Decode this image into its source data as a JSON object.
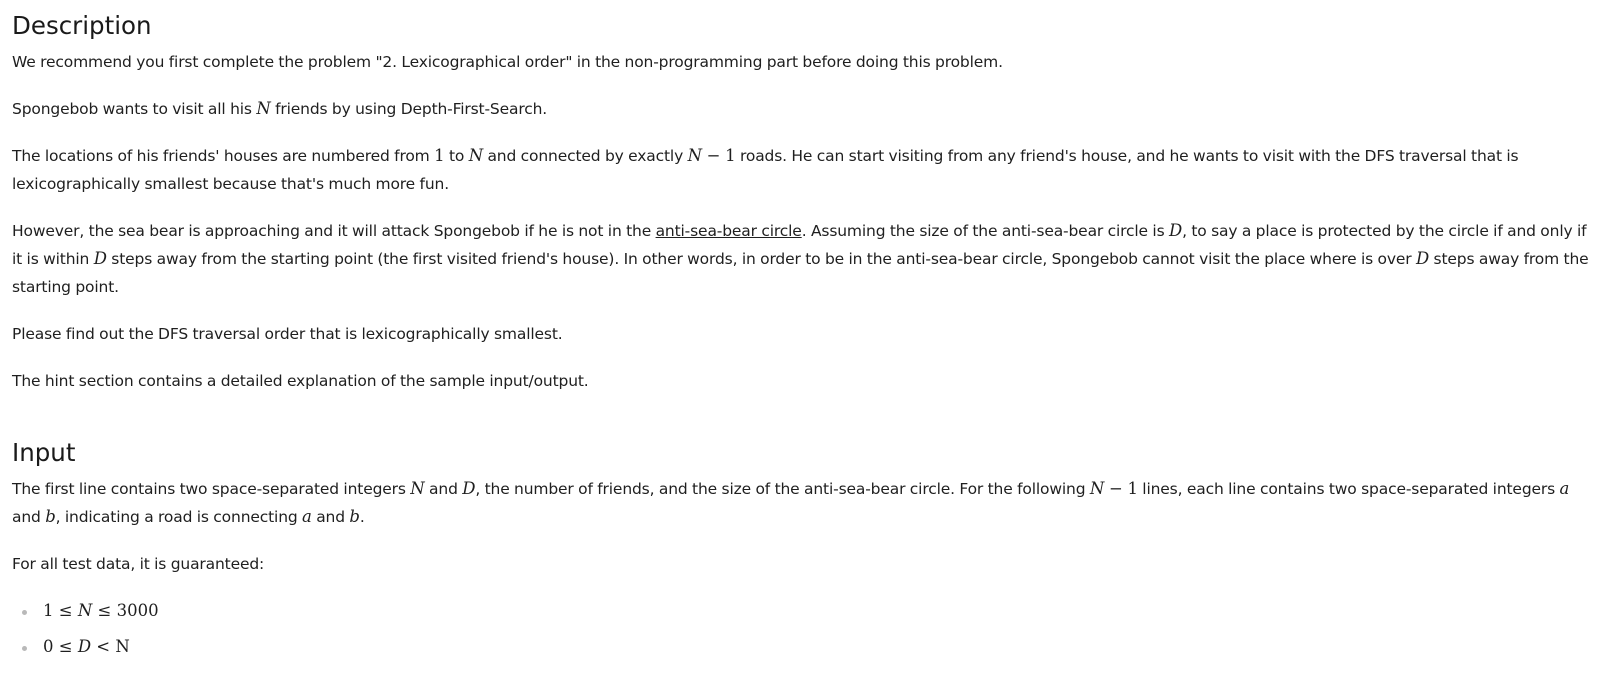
{
  "description": {
    "heading": "Description",
    "p1": "We recommend you first complete the problem \"2. Lexicographical order\" in the non-programming part before doing this problem.",
    "p2": {
      "before": "Spongebob wants to visit all his ",
      "var_n": "N",
      "after": " friends by using Depth-First-Search."
    },
    "p3": {
      "s1": "The locations of his friends' houses are numbered from ",
      "one": "1",
      "s2": " to ",
      "var_n": "N",
      "s3": " and connected by exactly ",
      "expr_n": "N",
      "expr_rest": " − 1",
      "s4": " roads. He can start visiting from any friend's house, and he wants to visit with the DFS traversal that is lexicographically smallest because that's much more fun."
    },
    "p4": {
      "s1": "However, the sea bear is approaching and it will attack Spongebob if he is not in the ",
      "link": "anti-sea-bear circle",
      "s2": ". Assuming the size of the anti-sea-bear circle is ",
      "var_d1": "D",
      "s3": ", to say a place is protected by the circle if and only if it is within ",
      "var_d2": "D",
      "s4": " steps away from the starting point (the first visited friend's house). In other words, in order to be in the anti-sea-bear circle, Spongebob cannot visit the place where is over ",
      "var_d3": "D",
      "s5": " steps away from the starting point."
    },
    "p5": "Please find out the DFS traversal order that is lexicographically smallest.",
    "p6": "The hint section contains a detailed explanation of the sample input/output."
  },
  "input": {
    "heading": "Input",
    "p1": {
      "s1": "The first line contains two space-separated integers ",
      "var_n": "N",
      "s2": " and ",
      "var_d": "D",
      "s3": ", the number of friends, and the size of the anti-sea-bear circle. For the following ",
      "expr_n": "N",
      "expr_rest": " − 1",
      "s4": " lines, each line contains two space-separated integers ",
      "var_a1": "a",
      "s5": " and ",
      "var_b1": "b",
      "s6": ", indicating a road is connecting ",
      "var_a2": "a",
      "s7": " and ",
      "var_b2": "b",
      "s8": "."
    },
    "p2": "For all test data, it is guaranteed:",
    "constraints": [
      {
        "lhs": "1 ≤ ",
        "var": "N",
        "rhs": " ≤ 3000"
      },
      {
        "lhs": "0 ≤ ",
        "var": "D",
        "rhs": " < N"
      }
    ]
  }
}
